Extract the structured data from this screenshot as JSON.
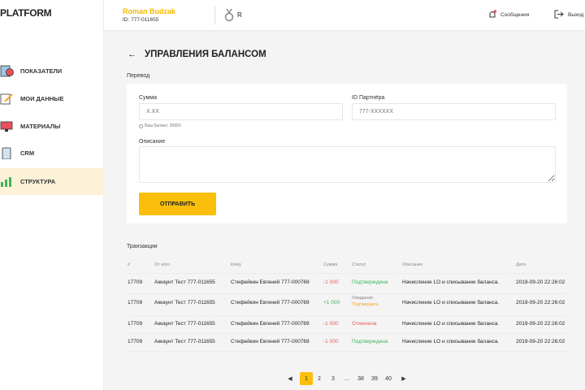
{
  "sidebar": {
    "logo": "PLATFORM",
    "items": [
      {
        "label": "ПОКАЗАТЕЛИ",
        "icon": "chart-icon"
      },
      {
        "label": "МОИ ДАННЫЕ",
        "icon": "edit-icon"
      },
      {
        "label": "МАТЕРИАЛЫ",
        "icon": "monitor-icon"
      },
      {
        "label": "CRM",
        "icon": "phone-icon"
      },
      {
        "label": "СТРУКТУРА",
        "icon": "structure-icon",
        "active": true
      }
    ]
  },
  "header": {
    "user_name": "Roman Budzak",
    "user_id": "ID: 777-011655",
    "rank": "R",
    "messages": "Сообщения",
    "logout": "Выход"
  },
  "page": {
    "title": "УПРАВЛЕНИЯ БАЛАНСОМ",
    "section": "Перевод"
  },
  "form": {
    "amount_label": "Сумма",
    "amount_placeholder": "X.XX",
    "partner_label": "ID Партнёра",
    "partner_placeholder": "777-XXXXXX",
    "balance_note": "Ваш баланс: 99950",
    "description_label": "Описание",
    "submit": "ОТПРАВИТЬ"
  },
  "transactions": {
    "title": "Транзакции",
    "columns": [
      "#",
      "От кого",
      "Кому",
      "Сумма",
      "Статус",
      "Описание",
      "Дата"
    ],
    "rows": [
      {
        "id": "17709",
        "from": "Аккаунт Тест 777-011655",
        "to": "Стефейкин Евгений 777-000769",
        "amount": "-1 000",
        "status": "Подтверждена",
        "status2": "",
        "desc": "Начисление LO и списывание баланса.",
        "date": "2019-09-20 22:26:02"
      },
      {
        "id": "17709",
        "from": "Аккаунт Тест 777-011655",
        "to": "Стефейкин Евгений 777-000769",
        "amount": "+1 000",
        "status": "Ожидание",
        "status2": "Подтвердить",
        "desc": "Начисление LO и списывание баланса.",
        "date": "2019-09-20 22:26:02"
      },
      {
        "id": "17709",
        "from": "Аккаунт Тест 777-011655",
        "to": "Стефейкин Евгений 777-000769",
        "amount": "-1 000",
        "status": "Отменена",
        "status2": "",
        "desc": "Начисление LO и списывание баланса.",
        "date": "2019-09-20 22:26:02"
      },
      {
        "id": "17709",
        "from": "Аккаунт Тест 777-011655",
        "to": "Стефейкин Евгений 777-000769",
        "amount": "-1 000",
        "status": "Подтверждена",
        "status2": "",
        "desc": "Начисление LO и списывание баланса.",
        "date": "2019-09-20 22:26:02"
      }
    ]
  },
  "pagination": {
    "prev": "◀",
    "pages": [
      "1",
      "2",
      "3",
      "...",
      "38",
      "39",
      "40"
    ],
    "current": "1",
    "next": "▶"
  },
  "colors": {
    "accent": "#fbbf0b",
    "green": "#3cb55a",
    "red": "#e85a5a",
    "orange": "#f5a623"
  }
}
